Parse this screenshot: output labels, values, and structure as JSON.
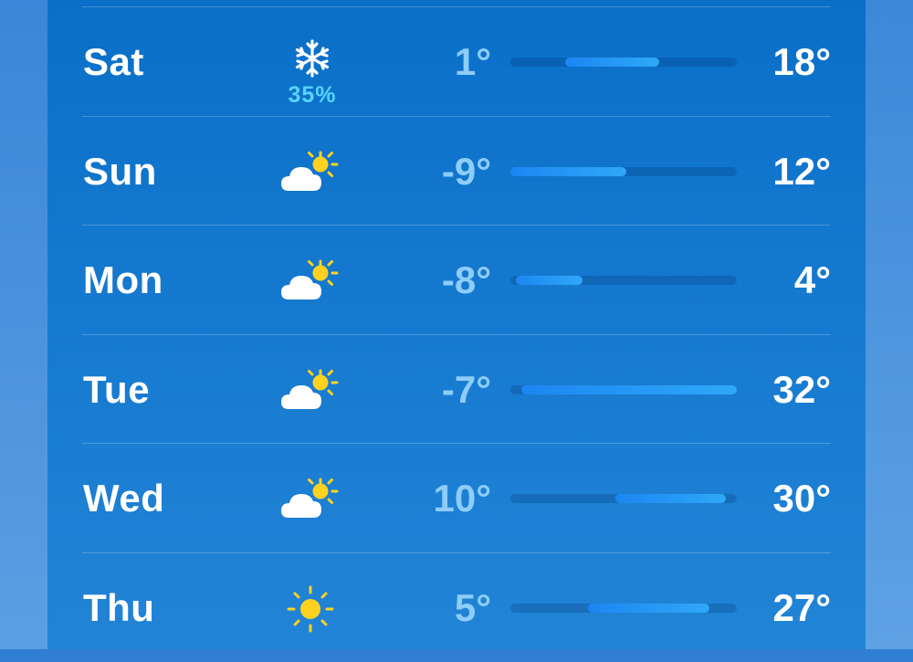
{
  "scale": {
    "min_temp": -9,
    "max_temp": 32
  },
  "colors": {
    "accent": "#1c86f2",
    "precip": "#57d4ff",
    "low_temp": "#8dcdf8",
    "high_temp": "#ffffff"
  },
  "forecast": [
    {
      "day": "Sat",
      "icon": "snowflake-icon",
      "precip": "35%",
      "low": "1°",
      "high": "18°",
      "low_value": 1,
      "high_value": 18
    },
    {
      "day": "Sun",
      "icon": "partly-cloudy-icon",
      "precip": "",
      "low": "-9°",
      "high": "12°",
      "low_value": -9,
      "high_value": 12
    },
    {
      "day": "Mon",
      "icon": "partly-cloudy-icon",
      "precip": "",
      "low": "-8°",
      "high": "4°",
      "low_value": -8,
      "high_value": 4
    },
    {
      "day": "Tue",
      "icon": "partly-cloudy-icon",
      "precip": "",
      "low": "-7°",
      "high": "32°",
      "low_value": -7,
      "high_value": 32
    },
    {
      "day": "Wed",
      "icon": "partly-cloudy-icon",
      "precip": "",
      "low": "10°",
      "high": "30°",
      "low_value": 10,
      "high_value": 30
    },
    {
      "day": "Thu",
      "icon": "sun-icon",
      "precip": "",
      "low": "5°",
      "high": "27°",
      "low_value": 5,
      "high_value": 27
    }
  ]
}
